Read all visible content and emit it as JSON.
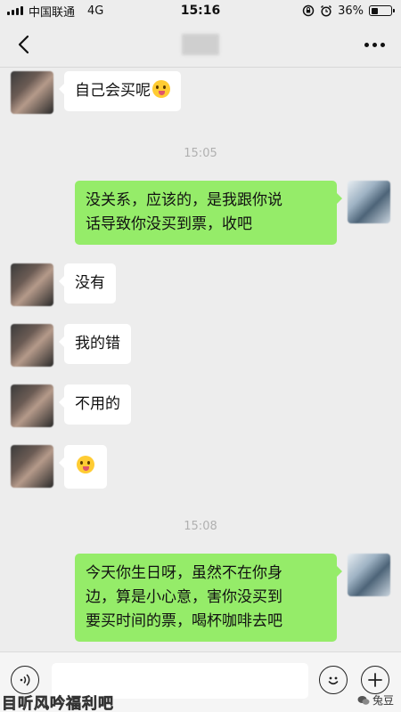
{
  "status_bar": {
    "carrier": "中国联通",
    "network": "4G",
    "time": "15:16",
    "battery": "36%",
    "battery_level": 0.36
  },
  "header": {
    "contact_name": "██"
  },
  "messages": [
    {
      "side": "left",
      "text": "自己会买呢",
      "emoji": "squinting-tongue"
    },
    {
      "type": "timestamp",
      "text": "15:05"
    },
    {
      "side": "right",
      "line1": "没关系，应该的，是我跟你说",
      "line2": "话导致你没买到票，收吧"
    },
    {
      "side": "left",
      "text": "没有"
    },
    {
      "side": "left",
      "text": "我的错"
    },
    {
      "side": "left",
      "text": "不用的"
    },
    {
      "side": "left",
      "text": "",
      "emoji": "squinting-tongue"
    },
    {
      "type": "timestamp",
      "text": "15:08"
    },
    {
      "side": "right",
      "line1": "今天你生日呀，虽然不在你身",
      "line2": "边，算是小心意，害你没买到",
      "line3": "要买时间的票，喝杯咖啡去吧"
    }
  ],
  "input_bar": {
    "placeholder": "",
    "voice_icon": "voice-icon",
    "emoji_icon": "emoji-icon",
    "plus_icon": "plus-icon"
  },
  "watermark": {
    "left": "目听风吟福利吧",
    "right": "兔豆"
  },
  "colors": {
    "background": "#ededed",
    "bubble_out": "#95ec69",
    "bubble_in": "#ffffff"
  }
}
